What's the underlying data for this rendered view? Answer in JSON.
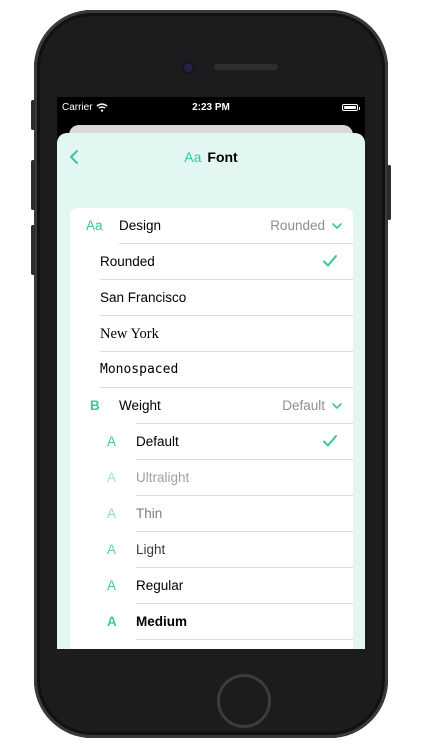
{
  "status_bar": {
    "carrier": "Carrier",
    "time": "2:23 PM"
  },
  "nav": {
    "title_icon": "Aa",
    "title": "Font"
  },
  "design": {
    "icon": "Aa",
    "label": "Design",
    "value": "Rounded",
    "options": [
      {
        "label": "Rounded",
        "selected": true
      },
      {
        "label": "San Francisco"
      },
      {
        "label": "New York"
      },
      {
        "label": "Monospaced"
      }
    ]
  },
  "weight": {
    "icon": "B",
    "label": "Weight",
    "value": "Default",
    "options": [
      {
        "glyph": "A",
        "label": "Default",
        "selected": true
      },
      {
        "glyph": "A",
        "label": "Ultralight"
      },
      {
        "glyph": "A",
        "label": "Thin"
      },
      {
        "glyph": "A",
        "label": "Light"
      },
      {
        "glyph": "A",
        "label": "Regular"
      },
      {
        "glyph": "A",
        "label": "Medium"
      }
    ]
  },
  "colors": {
    "accent": "#3cc4a0",
    "sheet_background": "#e3f7f2",
    "secondary_text": "#8e8e93"
  }
}
